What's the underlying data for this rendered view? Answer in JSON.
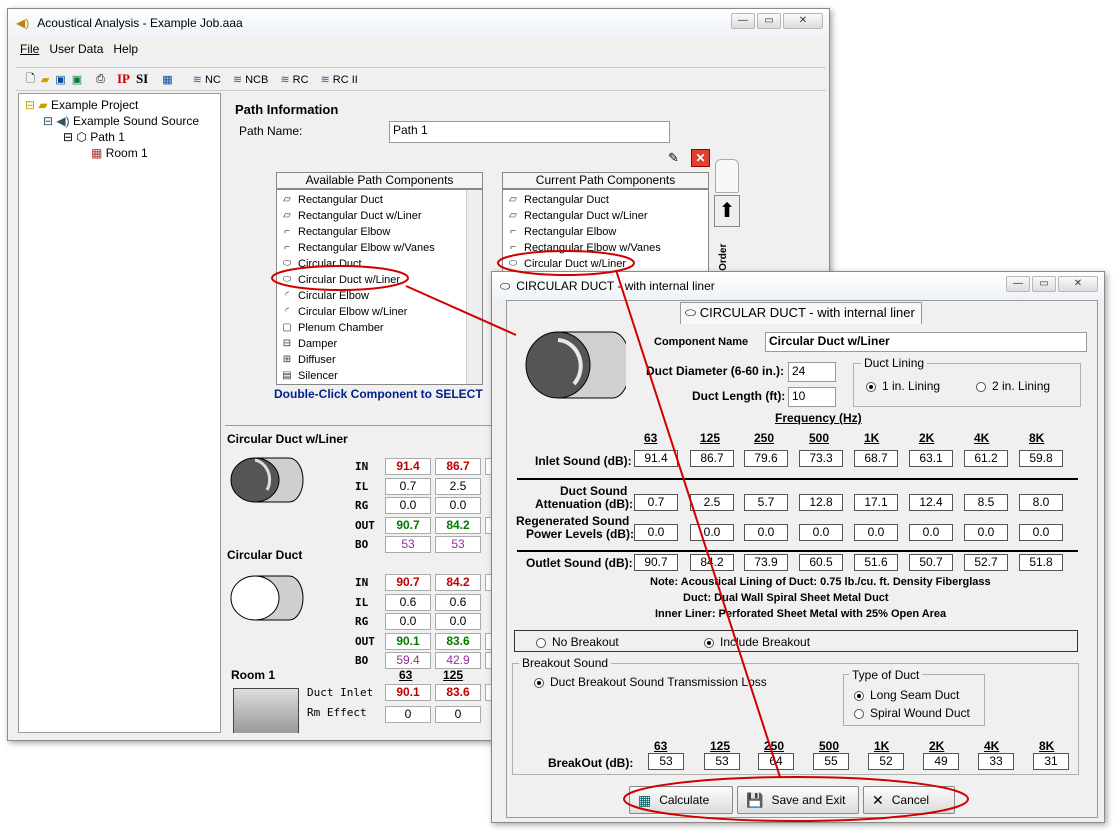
{
  "main_window": {
    "title": "Acoustical Analysis - Example Job.aaa",
    "menu": [
      "File",
      "User Data",
      "Help"
    ],
    "toolbar_units": [
      "IP",
      "SI"
    ],
    "toolbar_charts": [
      "NC",
      "NCB",
      "RC",
      "RC II"
    ],
    "tree": [
      "Example Project",
      "Example Sound Source",
      "Path 1",
      "Room 1"
    ],
    "path_info_title": "Path Information",
    "path_name_label": "Path Name:",
    "path_name_value": "Path 1",
    "available_header": "Available Path Components",
    "available_items": [
      "Rectangular Duct",
      "Rectangular Duct w/Liner",
      "Rectangular Elbow",
      "Rectangular Elbow w/Vanes",
      "Circular Duct",
      "Circular Duct w/Liner",
      "Circular Elbow",
      "Circular Elbow w/Liner",
      "Plenum Chamber",
      "Damper",
      "Diffuser",
      "Silencer"
    ],
    "available_icons": [
      "duct-icon",
      "duct-icon",
      "elbow-icon",
      "elbow-icon",
      "circular-duct-icon",
      "circular-duct-icon",
      "circular-elbow-icon",
      "circular-elbow-icon",
      "plenum-icon",
      "damper-icon",
      "diffuser-icon",
      "silencer-icon"
    ],
    "current_header": "Current Path Components",
    "current_items": [
      "Rectangular Duct",
      "Rectangular Duct w/Liner",
      "Rectangular Elbow",
      "Rectangular Elbow w/Vanes",
      "Circular Duct w/Liner"
    ],
    "double_click_hint": "Double-Click Component to SELECT",
    "order_label": "t Order",
    "summary1_title": "Circular Duct w/Liner",
    "summary2_title": "Circular Duct",
    "row_labels": [
      "IN",
      "IL",
      "RG",
      "OUT",
      "BO"
    ],
    "s1": {
      "IN": [
        "91.4",
        "86.7",
        "7"
      ],
      "IL": [
        "0.7",
        "2.5"
      ],
      "RG": [
        "0.0",
        "0.0"
      ],
      "OUT": [
        "90.7",
        "84.2",
        "7"
      ],
      "BO": [
        "53",
        "53"
      ]
    },
    "s2": {
      "IN": [
        "90.7",
        "84.2",
        "7"
      ],
      "IL": [
        "0.6",
        "0.6"
      ],
      "RG": [
        "0.0",
        "0.0"
      ],
      "OUT": [
        "90.1",
        "83.6",
        "7"
      ],
      "BO": [
        "59.4",
        "42.9",
        "3"
      ]
    },
    "room_title": "Room 1",
    "room_freqs": [
      "63",
      "125",
      "2"
    ],
    "duct_inlet_label": "Duct Inlet",
    "duct_inlet": [
      "90.1",
      "83.6",
      "7"
    ],
    "rm_effect_label": "Rm Effect",
    "rm_effect": [
      "0",
      "0"
    ]
  },
  "dialog": {
    "title": "CIRCULAR DUCT - with internal liner",
    "tab_label": "CIRCULAR DUCT - with internal liner",
    "component_name_label": "Component Name",
    "component_name_value": "Circular Duct w/Liner",
    "diameter_label": "Duct Diameter (6-60 in.):",
    "diameter_value": "24",
    "length_label": "Duct Length (ft):",
    "length_value": "10",
    "lining_group": "Duct Lining",
    "lining_options": [
      "1 in. Lining",
      "2 in. Lining"
    ],
    "frequency_title": "Frequency (Hz)",
    "freqs": [
      "63",
      "125",
      "250",
      "500",
      "1K",
      "2K",
      "4K",
      "8K"
    ],
    "inlet_label": "Inlet Sound (dB):",
    "inlet": [
      "91.4",
      "86.7",
      "79.6",
      "73.3",
      "68.7",
      "63.1",
      "61.2",
      "59.8"
    ],
    "atten_label1": "Duct Sound",
    "atten_label2": "Attenuation (dB):",
    "atten": [
      "0.7",
      "2.5",
      "5.7",
      "12.8",
      "17.1",
      "12.4",
      "8.5",
      "8.0"
    ],
    "regen_label1": "Regenerated Sound",
    "regen_label2": "Power Levels (dB):",
    "regen": [
      "0.0",
      "0.0",
      "0.0",
      "0.0",
      "0.0",
      "0.0",
      "0.0",
      "0.0"
    ],
    "outlet_label": "Outlet Sound (dB):",
    "outlet": [
      "90.7",
      "84.2",
      "73.9",
      "60.5",
      "51.6",
      "50.7",
      "52.7",
      "51.8"
    ],
    "note1": "Note: Acoustical Lining of Duct: 0.75 lb./cu. ft. Density Fiberglass",
    "note2": "Duct: Dual Wall Spiral Sheet Metal Duct",
    "note3": "Inner Liner: Perforated Sheet Metal with 25% Open Area",
    "breakout_options": [
      "No Breakout",
      "Include Breakout"
    ],
    "breakout_group": "Breakout Sound",
    "breakout_method": "Duct Breakout Sound Transmission Loss",
    "type_group": "Type of Duct",
    "type_options": [
      "Long Seam Duct",
      "Spiral Wound Duct"
    ],
    "breakout_label": "BreakOut  (dB):",
    "breakout": [
      "53",
      "53",
      "64",
      "55",
      "52",
      "49",
      "33",
      "31"
    ],
    "buttons": [
      "Calculate",
      "Save and Exit",
      "Cancel"
    ]
  },
  "colors": {
    "highlight_red": "#d00000",
    "value_red": "#c00000",
    "value_green": "#007a00",
    "value_purple": "#9a2aa0"
  }
}
